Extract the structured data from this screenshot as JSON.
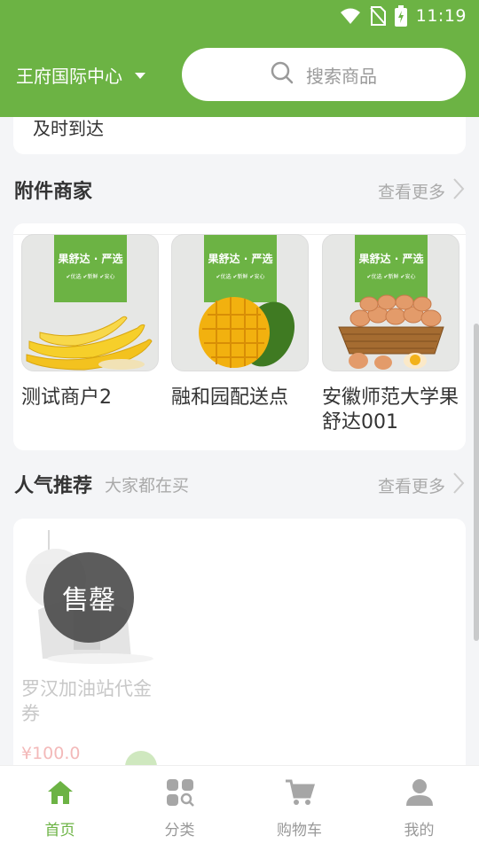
{
  "status_bar": {
    "time": "11:19"
  },
  "header": {
    "location": "王府国际中心",
    "search_placeholder": "搜索商品"
  },
  "top_card": {
    "text": "及时到达"
  },
  "nearby": {
    "title": "附件商家",
    "more": "查看更多",
    "merchants": [
      {
        "name": "测试商户2",
        "banner": "果舒达 · 严选",
        "banner_sub": "✔优选  ✔新鲜  ✔安心",
        "image": "banana"
      },
      {
        "name": "融和园配送点",
        "banner": "果舒达 · 严选",
        "banner_sub": "✔优选  ✔新鲜  ✔安心",
        "image": "mango"
      },
      {
        "name": "安徽师范大学果舒达001",
        "banner": "果舒达 · 严选",
        "banner_sub": "✔优选  ✔新鲜  ✔安心",
        "image": "eggs"
      }
    ]
  },
  "popular": {
    "title": "人气推荐",
    "subtitle": "大家都在买",
    "more": "查看更多",
    "products": [
      {
        "name": "罗汉加油站代金券",
        "price": "¥100.0",
        "badge": "售罄"
      }
    ]
  },
  "bottom_nav": [
    {
      "label": "首页",
      "icon": "home-icon",
      "active": true
    },
    {
      "label": "分类",
      "icon": "category-icon",
      "active": false
    },
    {
      "label": "购物车",
      "icon": "cart-icon",
      "active": false
    },
    {
      "label": "我的",
      "icon": "user-icon",
      "active": false
    }
  ],
  "colors": {
    "brand": "#6cb344",
    "bg": "#f4f5f7",
    "muted": "#aaaaaa",
    "price": "#f3b9b9"
  }
}
